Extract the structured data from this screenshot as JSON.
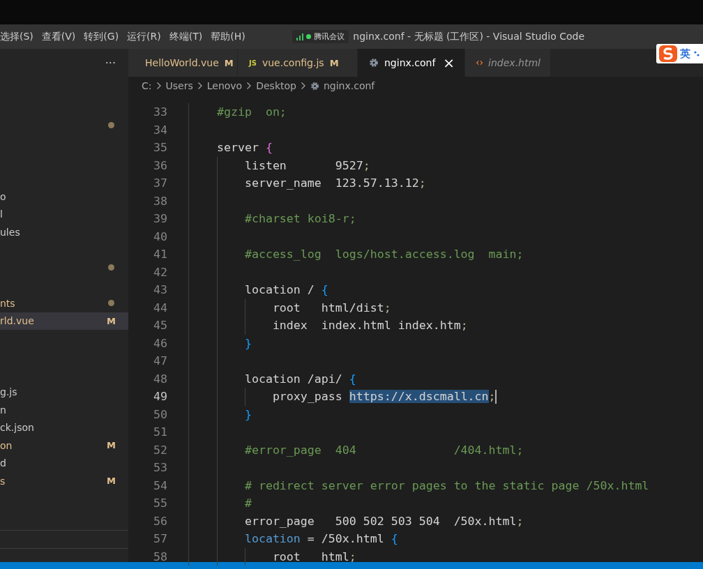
{
  "menu": [
    {
      "label": "选择(S)"
    },
    {
      "label": "查看(V)"
    },
    {
      "label": "转到(G)"
    },
    {
      "label": "运行(R)"
    },
    {
      "label": "终端(T)"
    },
    {
      "label": "帮助(H)"
    }
  ],
  "meeting_badge": {
    "label": "腾讯会议"
  },
  "window": {
    "title": "nginx.conf - 无标题 (工作区) - Visual Studio Code"
  },
  "ime": {
    "label": "英"
  },
  "sidebar": {
    "more": "···",
    "items": [
      {
        "kind": "spacer"
      },
      {
        "kind": "spacer"
      },
      {
        "kind": "file",
        "dot": true,
        "modified": true,
        "selected": false
      },
      {
        "kind": "spacer"
      },
      {
        "kind": "spacer"
      },
      {
        "kind": "spacer"
      },
      {
        "kind": "file",
        "text": "o",
        "modified": false,
        "selected": false
      },
      {
        "kind": "file",
        "text": "l",
        "modified": false,
        "selected": false
      },
      {
        "kind": "file",
        "text": "ules",
        "modified": false,
        "selected": false
      },
      {
        "kind": "spacer"
      },
      {
        "kind": "file",
        "dot": true,
        "modified": true,
        "selected": false
      },
      {
        "kind": "spacer"
      },
      {
        "kind": "file",
        "text": "nts",
        "dot": true,
        "modified": true,
        "selected": false
      },
      {
        "kind": "file",
        "text": "rld.vue",
        "badge": "M",
        "modified": true,
        "selected": true
      },
      {
        "kind": "spacer"
      },
      {
        "kind": "spacer"
      },
      {
        "kind": "spacer"
      },
      {
        "kind": "file",
        "text": "g.js",
        "modified": false,
        "selected": false
      },
      {
        "kind": "file",
        "text": "n",
        "modified": false,
        "selected": false
      },
      {
        "kind": "file",
        "text": "ck.json",
        "modified": false,
        "selected": false
      },
      {
        "kind": "file",
        "text": "on",
        "badge": "M",
        "modified": true,
        "selected": false
      },
      {
        "kind": "file",
        "text": "d",
        "modified": false,
        "selected": false
      },
      {
        "kind": "file",
        "text": "s",
        "badge": "M",
        "modified": true,
        "selected": false
      }
    ]
  },
  "tabs": [
    {
      "label": "HelloWorld.vue",
      "kind": "vue",
      "badge": "M",
      "modified": true,
      "selected": false,
      "preview": false
    },
    {
      "label": "vue.config.js",
      "kind": "js",
      "icon_text": "JS",
      "badge": "M",
      "modified": true,
      "selected": false,
      "preview": false
    },
    {
      "label": "nginx.conf",
      "kind": "config",
      "close": "×",
      "modified": false,
      "selected": true,
      "preview": false
    },
    {
      "label": "index.html",
      "kind": "html",
      "modified": false,
      "selected": false,
      "preview": true
    }
  ],
  "breadcrumb": [
    {
      "label": "C:",
      "kind": "folder"
    },
    {
      "label": "Users",
      "kind": "folder"
    },
    {
      "label": "Lenovo",
      "kind": "folder"
    },
    {
      "label": "Desktop",
      "kind": "folder"
    },
    {
      "label": "nginx.conf",
      "kind": "config"
    }
  ],
  "editor": {
    "lines": [
      {
        "number": "33",
        "current": false,
        "tokens": [
          {
            "text": "    #gzip  on;",
            "kind": "comment"
          }
        ]
      },
      {
        "number": "34",
        "current": false
      },
      {
        "number": "35",
        "current": false,
        "tokens": [
          {
            "text": "    server "
          },
          {
            "text": "{",
            "kind": "brace1"
          }
        ]
      },
      {
        "number": "36",
        "current": false,
        "tokens": [
          {
            "text": "        listen       9527"
          },
          {
            "text": ";",
            "kind": "punct"
          }
        ]
      },
      {
        "number": "37",
        "current": false,
        "tokens": [
          {
            "text": "        server_name  123.57.13.12"
          },
          {
            "text": ";",
            "kind": "punct"
          }
        ]
      },
      {
        "number": "38",
        "current": false
      },
      {
        "number": "39",
        "current": false,
        "tokens": [
          {
            "text": "        #charset koi8-r;",
            "kind": "comment"
          }
        ]
      },
      {
        "number": "40",
        "current": false
      },
      {
        "number": "41",
        "current": false,
        "tokens": [
          {
            "text": "        #access_log  logs/host.access.log  main;",
            "kind": "comment"
          }
        ]
      },
      {
        "number": "42",
        "current": false
      },
      {
        "number": "43",
        "current": false,
        "tokens": [
          {
            "text": "        location / "
          },
          {
            "text": "{",
            "kind": "brace2"
          }
        ]
      },
      {
        "number": "44",
        "current": false,
        "tokens": [
          {
            "text": "            root   html/dist"
          },
          {
            "text": ";",
            "kind": "punct"
          }
        ]
      },
      {
        "number": "45",
        "current": false,
        "tokens": [
          {
            "text": "            index  index.html index.htm"
          },
          {
            "text": ";",
            "kind": "punct"
          }
        ]
      },
      {
        "number": "46",
        "current": false,
        "tokens": [
          {
            "text": "        }",
            "kind": "brace2"
          }
        ]
      },
      {
        "number": "47",
        "current": false
      },
      {
        "number": "48",
        "current": false,
        "tokens": [
          {
            "text": "        location /api/ "
          },
          {
            "text": "{",
            "kind": "brace2"
          }
        ]
      },
      {
        "number": "49",
        "current": true,
        "tokens": [
          {
            "text": "            proxy_pass "
          },
          {
            "text": "https://x.dscmall.cn",
            "kind": "selection"
          },
          {
            "text": ";",
            "kind": "punct"
          }
        ]
      },
      {
        "number": "50",
        "current": false,
        "tokens": [
          {
            "text": "        }",
            "kind": "brace2"
          }
        ]
      },
      {
        "number": "51",
        "current": false
      },
      {
        "number": "52",
        "current": false,
        "tokens": [
          {
            "text": "        #error_page  404              /404.html;",
            "kind": "comment"
          }
        ]
      },
      {
        "number": "53",
        "current": false
      },
      {
        "number": "54",
        "current": false,
        "tokens": [
          {
            "text": "        # redirect server error pages to the static page /50x.html",
            "kind": "comment"
          }
        ]
      },
      {
        "number": "55",
        "current": false,
        "tokens": [
          {
            "text": "        #",
            "kind": "comment"
          }
        ]
      },
      {
        "number": "56",
        "current": false,
        "tokens": [
          {
            "text": "        error_page   500 502 503 504  /50x.html"
          },
          {
            "text": ";",
            "kind": "punct"
          }
        ]
      },
      {
        "number": "57",
        "current": false,
        "tokens": [
          {
            "text": "        location",
            "kind": "keyword"
          },
          {
            "text": " = /50x.html "
          },
          {
            "text": "{",
            "kind": "brace2"
          }
        ]
      },
      {
        "number": "58",
        "current": false,
        "tokens": [
          {
            "text": "            root   html"
          },
          {
            "text": ";",
            "kind": "punct"
          }
        ]
      }
    ]
  }
}
